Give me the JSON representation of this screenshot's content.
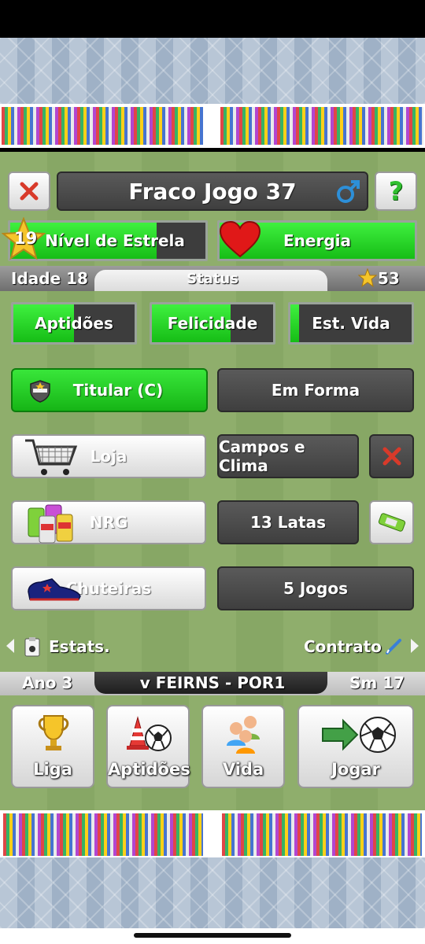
{
  "header": {
    "title": "Fraco Jogo 37",
    "close_icon": "close-icon",
    "gender_icon": "male-symbol-icon",
    "help_label": "?"
  },
  "stats_bars": {
    "star_level": {
      "number": "19",
      "label": "Nível de Estrela",
      "fill": 0.8
    },
    "energy": {
      "label": "Energia",
      "fill": 1.0
    }
  },
  "status_strip": {
    "age": "Idade 18",
    "title": "Status",
    "money": "53"
  },
  "attributes": [
    {
      "label": "Aptidões",
      "fill": 0.5
    },
    {
      "label": "Felicidade",
      "fill": 0.65
    },
    {
      "label": "Est. Vida",
      "fill": 0.05
    }
  ],
  "rows": {
    "position": "Titular (C)",
    "form": "Em Forma",
    "shop": "Loja",
    "fields": "Campos e Clima",
    "nrg": "NRG",
    "cans": "13 Latas",
    "boots": "Chuteiras",
    "games": "5 Jogos"
  },
  "nav": {
    "stats": "Estats.",
    "contract": "Contrato"
  },
  "season_strip": {
    "year": "Ano 3",
    "match": "v FEIRNS - POR1",
    "week": "Sm 17"
  },
  "menu": [
    {
      "label": "Liga",
      "icon": "trophy-icon"
    },
    {
      "label": "Aptidões",
      "icon": "cone-ball-icon"
    },
    {
      "label": "Vida",
      "icon": "people-icon"
    },
    {
      "label": "Jogar",
      "icon": "arrow-ball-icon"
    }
  ],
  "colors": {
    "green": "#22c922",
    "dark": "#4a4a4a",
    "red_x": "#d83a2a"
  }
}
